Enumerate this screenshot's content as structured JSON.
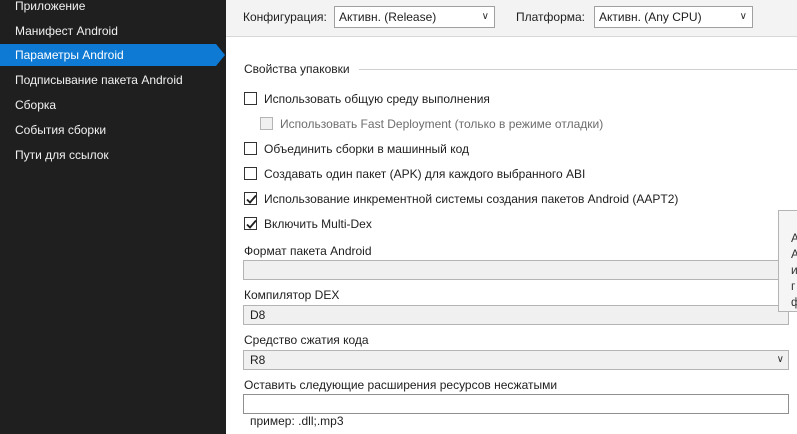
{
  "sidebar": {
    "items": [
      {
        "label": "Приложение"
      },
      {
        "label": "Манифест Android"
      },
      {
        "label": "Параметры Android",
        "selected": true
      },
      {
        "label": "Подписывание пакета Android"
      },
      {
        "label": "Сборка"
      },
      {
        "label": "События сборки"
      },
      {
        "label": "Пути для ссылок"
      }
    ]
  },
  "toolbar": {
    "configuration_label": "Конфигурация:",
    "configuration_value": "Активн. (Release)",
    "platform_label": "Платформа:",
    "platform_value": "Активн. (Any CPU)"
  },
  "packaging": {
    "group_title": "Свойства упаковки",
    "checkboxes": [
      {
        "label": "Использовать общую среду выполнения",
        "checked": false,
        "enabled": true
      },
      {
        "label": "Использовать Fast Deployment (только в режиме отладки)",
        "checked": false,
        "enabled": false
      },
      {
        "label": "Объединить сборки в машинный код",
        "checked": false,
        "enabled": true
      },
      {
        "label": "Создавать один пакет (APK) для каждого выбранного ABI",
        "checked": false,
        "enabled": true
      },
      {
        "label": "Использование инкрементной системы создания пакетов Android (AAPT2)",
        "checked": true,
        "enabled": true
      },
      {
        "label": "Включить Multi-Dex",
        "checked": true,
        "enabled": true
      }
    ],
    "package_format_label": "Формат пакета Android",
    "package_format_value": "",
    "dex_compiler_label": "Компилятор DEX",
    "dex_compiler_value": "D8",
    "code_shrinker_label": "Средство сжатия кода",
    "code_shrinker_value": "R8",
    "uncompressed_label": "Оставить следующие расширения ресурсов несжатыми",
    "uncompressed_value": "",
    "uncompressed_hint": "пример: .dll;.mp3"
  },
  "tooltip": {
    "lines": [
      "А",
      "А",
      "и",
      "г",
      "ф"
    ]
  },
  "colors": {
    "sidebar_bg": "#1f1f1f",
    "selected_bg": "#0e7ad4",
    "toolbar_bg": "#f3f3f3"
  }
}
